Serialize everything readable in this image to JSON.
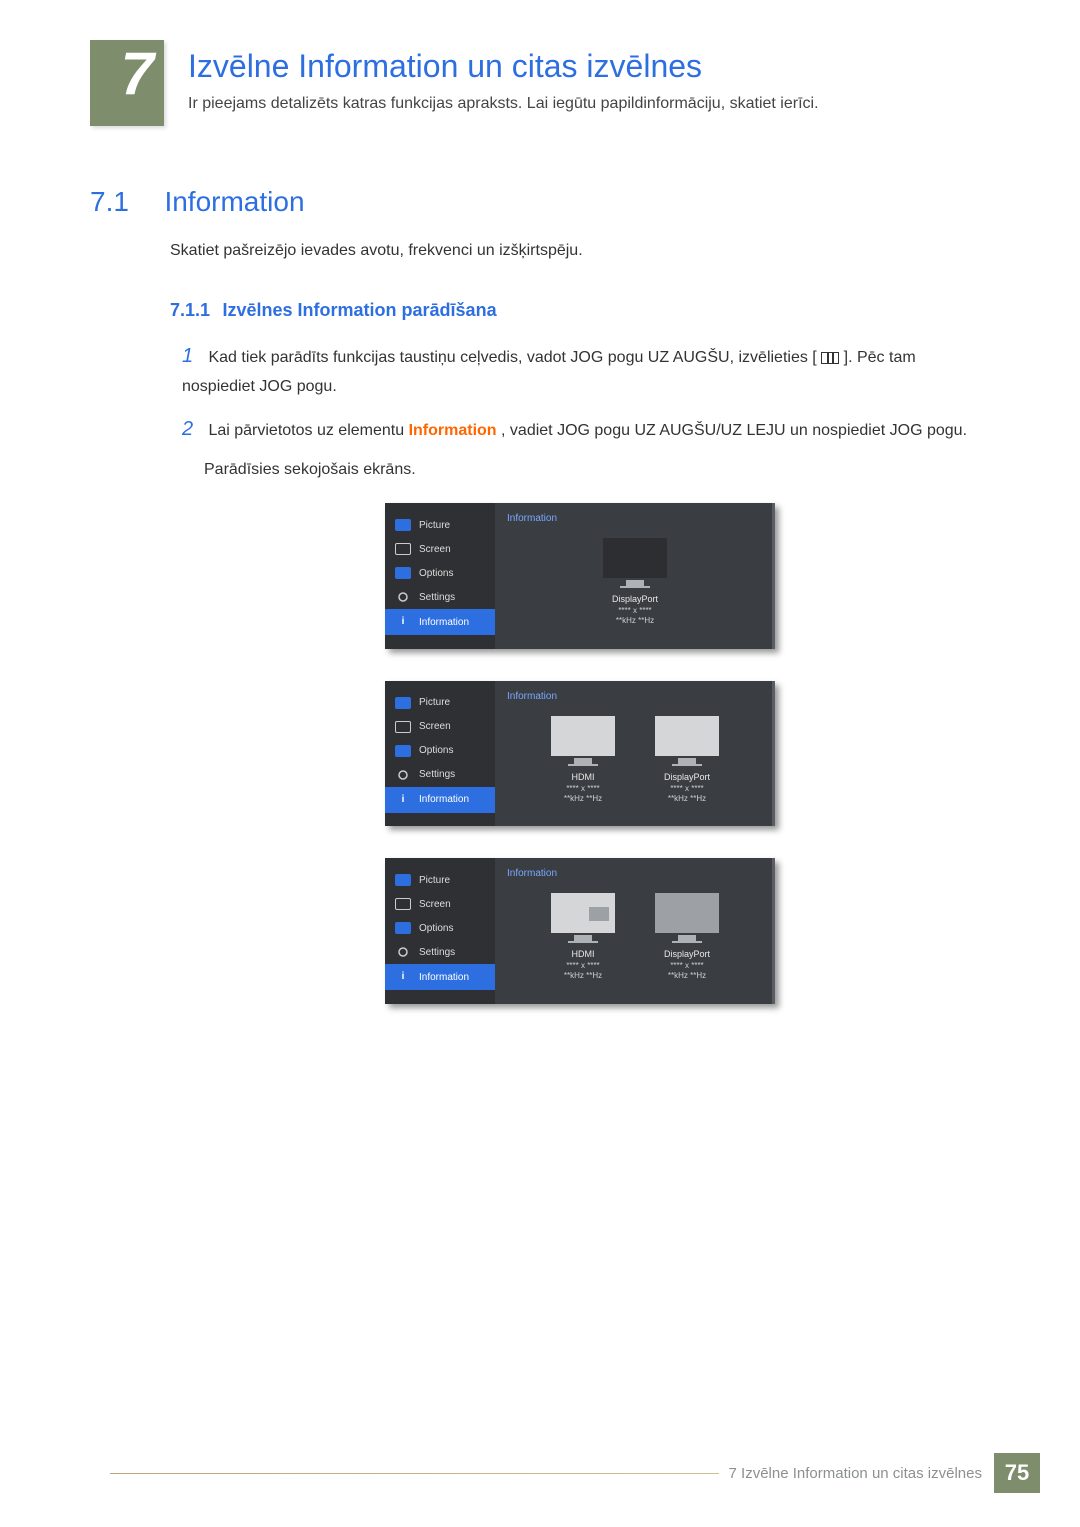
{
  "chapter": {
    "number": "7",
    "title": "Izvēlne Information un citas izvēlnes",
    "description": "Ir pieejams detalizēts katras funkcijas apraksts. Lai iegūtu papildinformāciju, skatiet ierīci."
  },
  "section": {
    "number": "7.1",
    "title": "Information",
    "body": "Skatiet pašreizējo ievades avotu, frekvenci un izšķirtspēju."
  },
  "subsection": {
    "number": "7.1.1",
    "title": "Izvēlnes Information parādīšana"
  },
  "steps": {
    "s1_a": "Kad tiek parādīts funkcijas taustiņu ceļvedis, vadot JOG pogu UZ AUGŠU, izvēlieties [",
    "s1_b": "]. Pēc tam nospiediet JOG pogu.",
    "s2_a": "Lai pārvietotos uz elementu ",
    "information_word": "Information",
    "s2_b": ", vadiet JOG pogu UZ AUGŠU/UZ LEJU un nospiediet JOG pogu.",
    "s2_c": "Parādīsies sekojošais ekrāns."
  },
  "osd": {
    "menu": [
      "Picture",
      "Screen",
      "Options",
      "Settings",
      "Information"
    ],
    "panel_title": "Information",
    "signals": {
      "displayport": "DisplayPort",
      "hdmi": "HDMI",
      "res": "**** x ****",
      "freq": "**kHz **Hz"
    }
  },
  "footer": {
    "text": "7 Izvēlne Information un citas izvēlnes",
    "page": "75"
  }
}
